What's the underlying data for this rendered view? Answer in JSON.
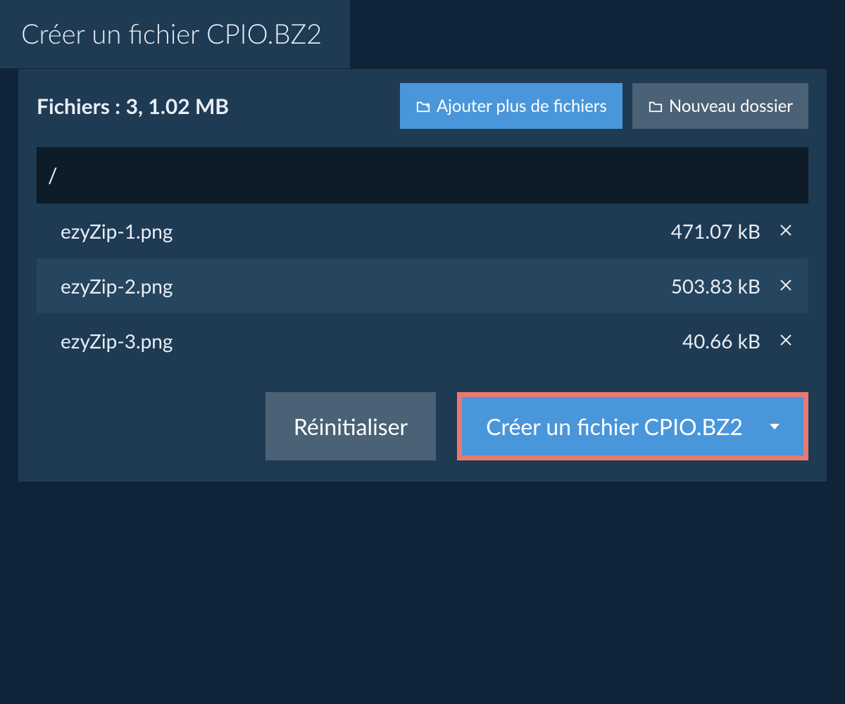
{
  "tab": {
    "title": "Créer un fichier CPIO.BZ2"
  },
  "summary": {
    "label": "Fichiers :",
    "count_and_size": "3, 1.02 MB"
  },
  "toolbar": {
    "add_more_label": "Ajouter plus de fichiers",
    "new_folder_label": "Nouveau dossier"
  },
  "path": "/",
  "files": [
    {
      "name": "ezyZip-1.png",
      "size": "471.07 kB"
    },
    {
      "name": "ezyZip-2.png",
      "size": "503.83 kB"
    },
    {
      "name": "ezyZip-3.png",
      "size": "40.66 kB"
    }
  ],
  "actions": {
    "reset_label": "Réinitialiser",
    "create_label": "Créer un fichier CPIO.BZ2"
  },
  "colors": {
    "accent_blue": "#4a96db",
    "panel_bg": "#1f3a53",
    "page_bg": "#0f2438",
    "highlight_border": "#e87a72"
  }
}
